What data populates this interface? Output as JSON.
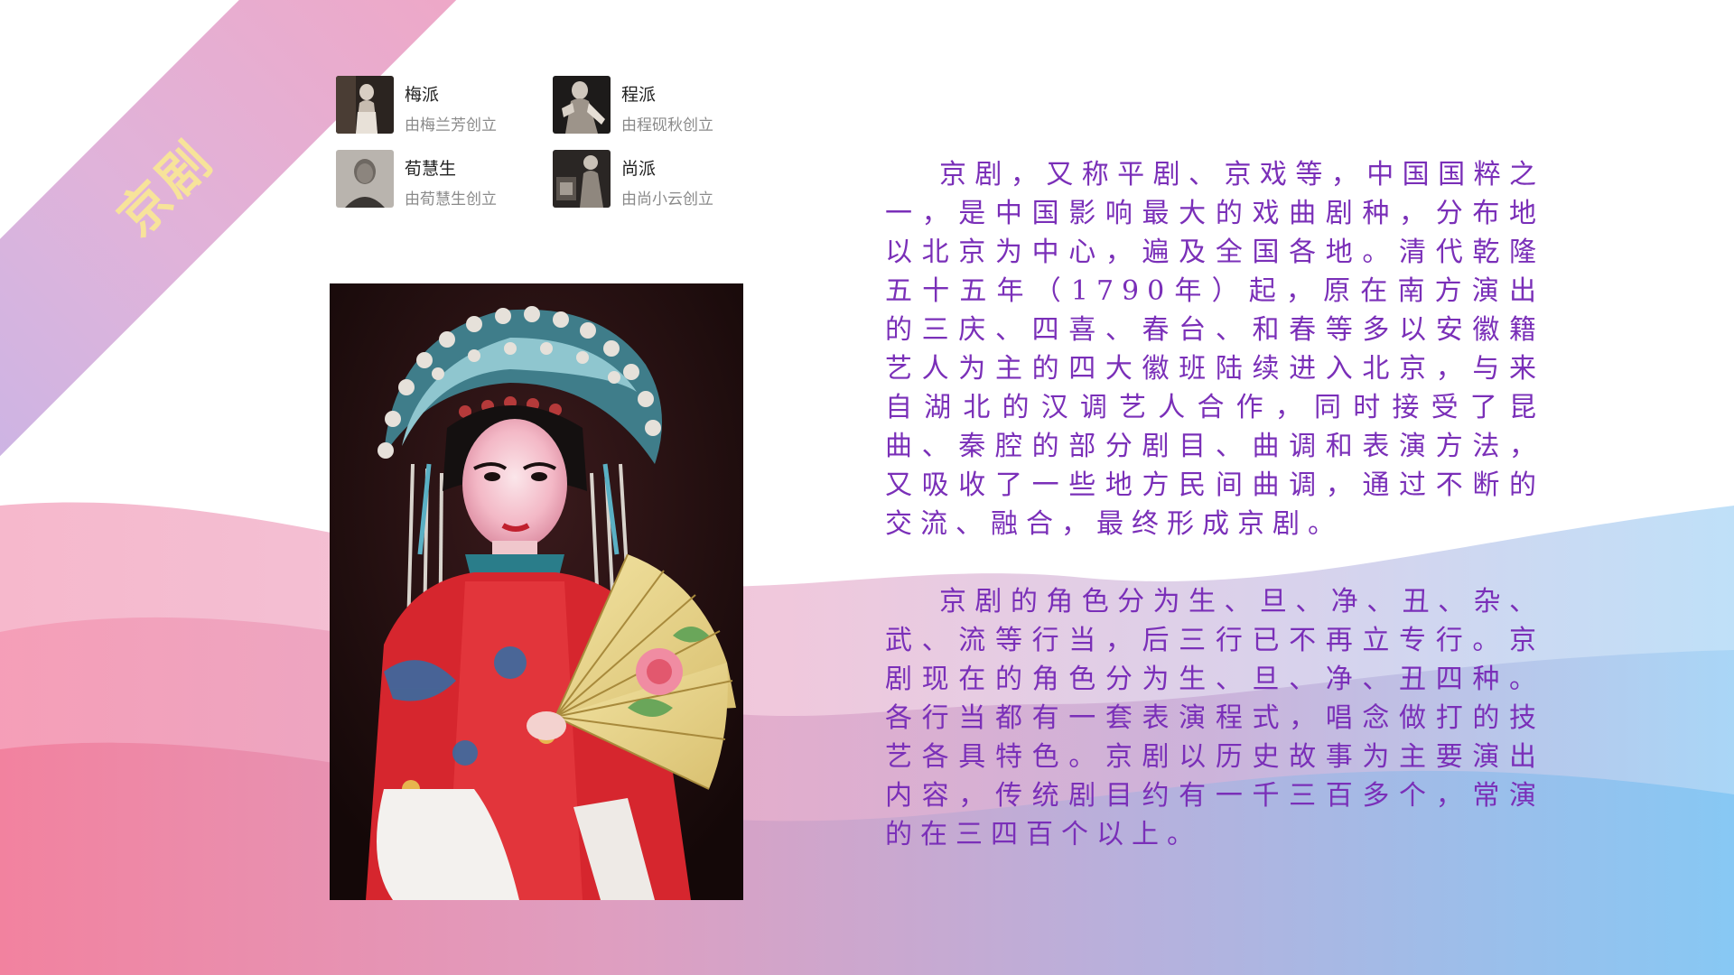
{
  "slide": {
    "title": "京剧",
    "colors": {
      "ribbon_gradient": [
        "#c9b5e6",
        "#efa7c6"
      ],
      "ribbon_text": "#f7e39a",
      "body_text": "#7a2fb8",
      "wave_pink": "#f38aa8",
      "wave_purple": "#c7a8d8",
      "wave_blue": "#8ccaf5"
    }
  },
  "schools": [
    {
      "name": "梅派",
      "desc": "由梅兰芳创立",
      "icon": "portrait-photo"
    },
    {
      "name": "程派",
      "desc": "由程砚秋创立",
      "icon": "portrait-photo"
    },
    {
      "name": "荀慧生",
      "desc": "由荀慧生创立",
      "icon": "portrait-photo"
    },
    {
      "name": "尚派",
      "desc": "由尚小云创立",
      "icon": "portrait-photo"
    }
  ],
  "photo": {
    "subject": "Peking opera performer in phoenix crown holding a painted fan",
    "icon": "performer-photo"
  },
  "body": {
    "paragraphs": [
      "京剧，又称平剧、京戏等，中国国粹之一，是中国影响最大的戏曲剧种，分布地以北京为中心，遍及全国各地。清代乾隆五十五年（1790年）起，原在南方演出的三庆、四喜、春台、和春等多以安徽籍艺人为主的四大徽班陆续进入北京，与来自湖北的汉调艺人合作，同时接受了昆曲、秦腔的部分剧目、曲调和表演方法，又吸收了一些地方民间曲调，通过不断的交流、融合，最终形成京剧。",
      "京剧的角色分为生、旦、净、丑、杂、武、流等行当，后三行已不再立专行。京剧现在的角色分为生、旦、净、丑四种。各行当都有一套表演程式，唱念做打的技艺各具特色。京剧以历史故事为主要演出内容，传统剧目约有一千三百多个，常演的在三四百个以上。"
    ]
  }
}
